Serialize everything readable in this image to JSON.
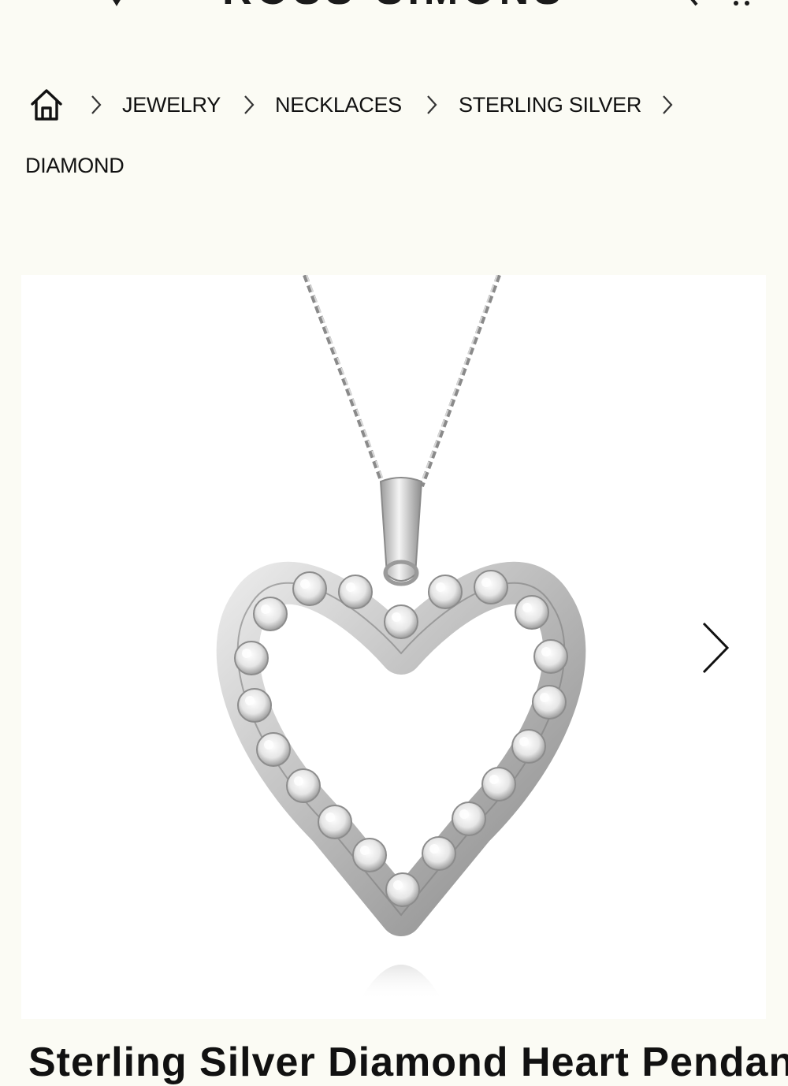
{
  "header": {
    "brand": "ROSS-SIMONS",
    "icons": [
      "wishlist-icon",
      "search-icon",
      "cart-icon"
    ]
  },
  "breadcrumb": {
    "home_icon": "home-icon",
    "separator_icon": "chevron-right-icon",
    "items": [
      "JEWELRY",
      "NECKLACES",
      "STERLING SILVER",
      "DIAMOND"
    ]
  },
  "gallery": {
    "image_subject": "Heart pendant necklace with diamonds on box chain",
    "next_icon": "chevron-right-icon"
  },
  "product": {
    "title": "Sterling Silver Diamond Heart Pendant"
  }
}
